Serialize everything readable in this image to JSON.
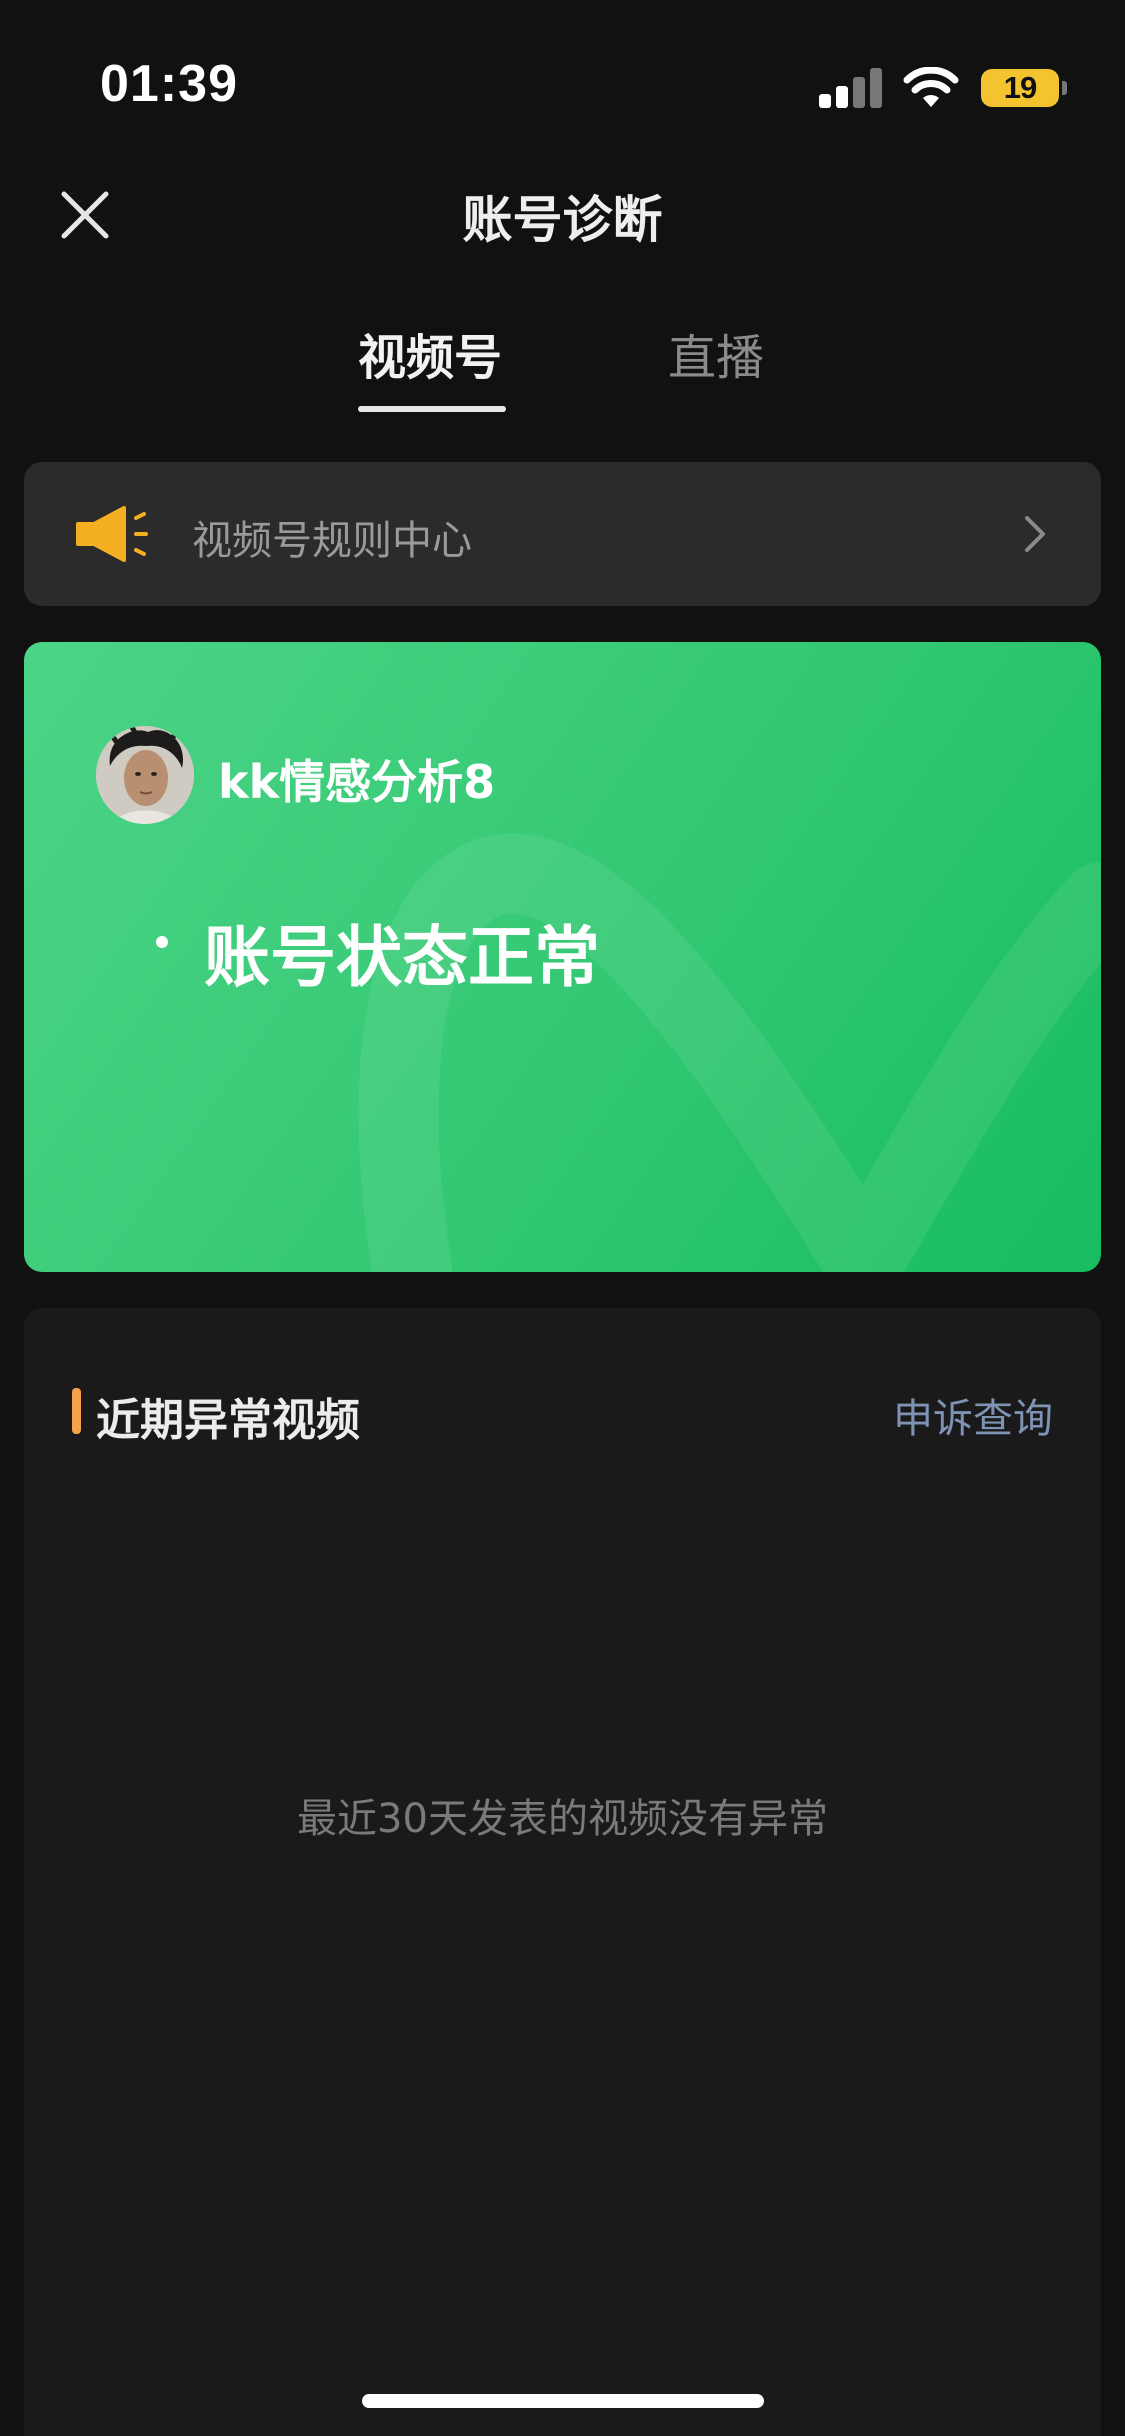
{
  "status_bar": {
    "time": "01:39",
    "battery_level": "19"
  },
  "nav": {
    "title": "账号诊断"
  },
  "tabs": [
    {
      "label": "视频号",
      "active": true
    },
    {
      "label": "直播",
      "active": false
    }
  ],
  "rules_banner": {
    "label": "视频号规则中心"
  },
  "account_card": {
    "name": "kk情感分析8",
    "status": "账号状态正常"
  },
  "anomaly_section": {
    "title": "近期异常视频",
    "appeal_link": "申诉查询",
    "empty_message": "最近30天发表的视频没有异常"
  },
  "colors": {
    "card_green": "#33c873",
    "accent_orange": "#f5a24b",
    "link_blue": "#7f93b4",
    "battery_yellow": "#f4c430"
  }
}
